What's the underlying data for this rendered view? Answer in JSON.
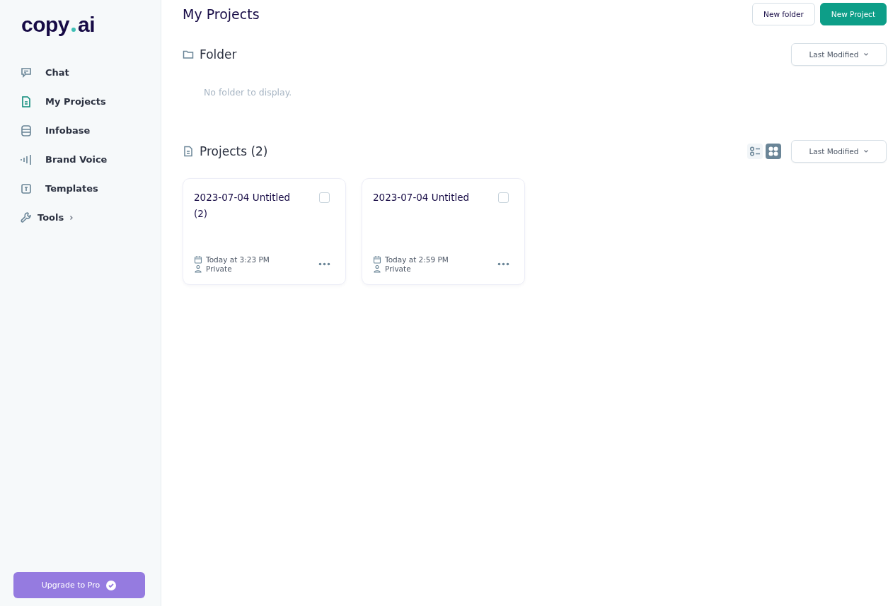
{
  "sidebar": {
    "logo": {
      "text": "copy",
      "suffix": "ai"
    },
    "items": [
      {
        "label": "Chat",
        "kind": "chat",
        "selected": false,
        "expandable": false
      },
      {
        "label": "My Projects",
        "kind": "file",
        "selected": true,
        "expandable": false
      },
      {
        "label": "Infobase",
        "kind": "database",
        "selected": false,
        "expandable": false
      },
      {
        "label": "Brand Voice",
        "kind": "wave",
        "selected": false,
        "expandable": false
      },
      {
        "label": "Templates",
        "kind": "template",
        "selected": false,
        "expandable": false
      },
      {
        "label": "Tools",
        "kind": "wrench",
        "selected": false,
        "expandable": true
      }
    ],
    "upgrade_button": "Upgrade to Pro"
  },
  "header": {
    "title": "My Projects",
    "buttons": [
      {
        "label": "New folder",
        "kind": "secondary"
      },
      {
        "label": "New Project",
        "kind": "primary"
      }
    ]
  },
  "folder_section": {
    "title": "Folder",
    "sort": "Last Modified",
    "empty_message": "No folder to display."
  },
  "projects_section": {
    "title": "Projects (2)",
    "sort": "Last Modified",
    "view_modes": [
      {
        "kind": "list",
        "selected": false
      },
      {
        "kind": "grid",
        "selected": true
      }
    ],
    "cards": [
      {
        "title": "2023-07-04 Untitled (2)",
        "modified": "Today at 3:23 PM",
        "visibility": "Private",
        "checked": false
      },
      {
        "title": "2023-07-04 Untitled",
        "modified": "Today at 2:59 PM",
        "visibility": "Private",
        "checked": false
      }
    ]
  }
}
